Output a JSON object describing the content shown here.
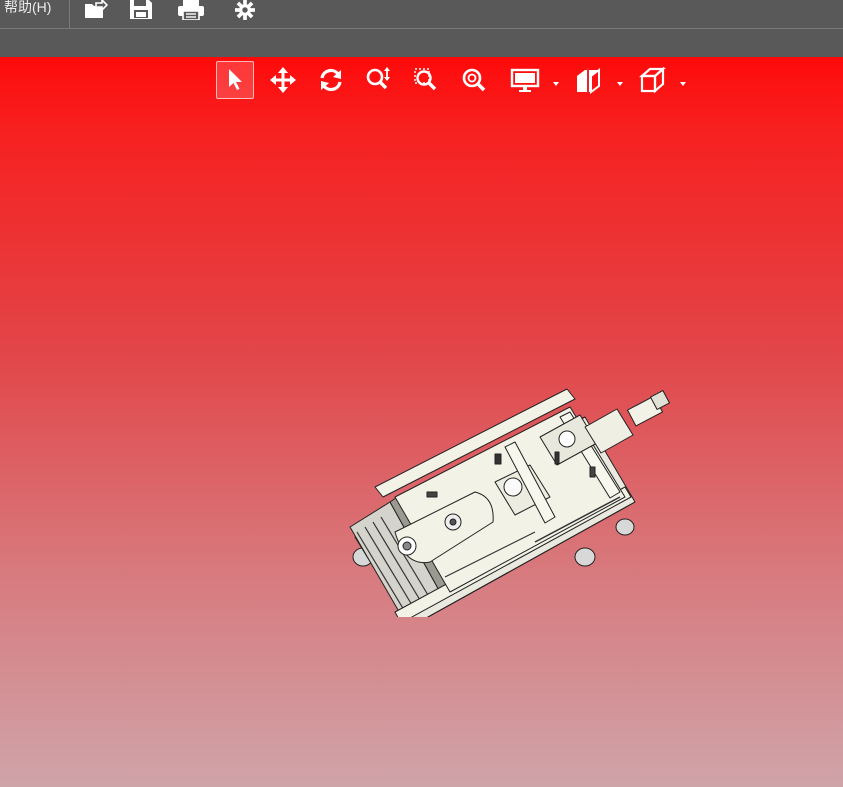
{
  "menu": {
    "help_label": "帮助(H)"
  },
  "toolbar": {
    "buttons": [
      {
        "name": "open-icon"
      },
      {
        "name": "save-icon"
      },
      {
        "name": "print-icon"
      },
      {
        "name": "gear-icon"
      }
    ]
  },
  "view_toolbar": {
    "tools": [
      {
        "name": "select-pointer-icon",
        "active": true
      },
      {
        "name": "pan-icon"
      },
      {
        "name": "rotate-icon"
      },
      {
        "name": "zoom-icon"
      },
      {
        "name": "zoom-window-icon"
      },
      {
        "name": "zoom-fit-icon"
      },
      {
        "name": "display-mode-icon"
      },
      {
        "name": "section-view-icon"
      },
      {
        "name": "standard-view-icon"
      }
    ]
  },
  "colors": {
    "viewport_top": "#ff0a0a",
    "viewport_bottom": "#cfa4a9",
    "toolbar_bg": "#595959",
    "model_fill": "#f2f2e6"
  }
}
